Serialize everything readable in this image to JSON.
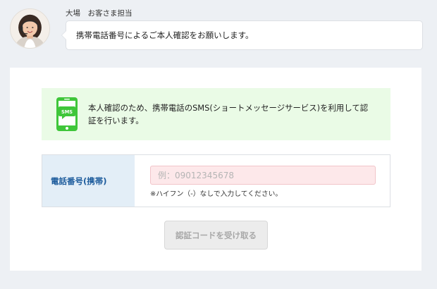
{
  "operator": {
    "name": "大場　お客さま担当",
    "message": "携帯電話番号によるご本人確認をお願いします。"
  },
  "notice": {
    "icon": "sms-phone-icon",
    "icon_label": "SMS",
    "text_line1": "本人確認のため、携帯電話のSMS(ショートメッセージサービス)を利用して認",
    "text_line2": "証を行います。"
  },
  "form": {
    "phone_label": "電話番号(携帯)",
    "phone_value": "",
    "phone_placeholder": "例：09012345678",
    "hint": "※ハイフン（-）なしで入力してください。"
  },
  "submit": {
    "label": "認証コードを受け取る",
    "enabled": false
  },
  "colors": {
    "page_background": "#edf0f4",
    "notice_background": "#eafbe6",
    "sms_icon_green": "#3fc63a",
    "label_background": "#e3eef7",
    "label_text": "#1c5b9c",
    "input_error_background": "#fde8ea",
    "button_disabled_background": "#ececec",
    "button_disabled_text": "#a8a8a8"
  }
}
